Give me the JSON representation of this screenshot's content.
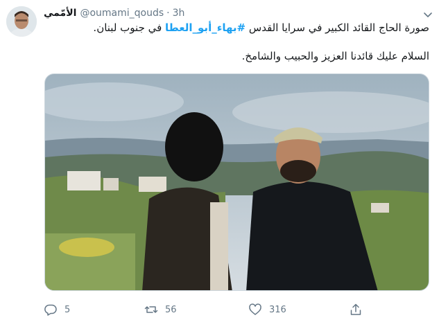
{
  "tweet": {
    "display_name": "الأمّمي",
    "handle": "@oumami_qouds",
    "separator": "·",
    "time": "3h",
    "text_line1_before": "صورة الحاج القائد الكبير في سرايا القدس ",
    "hashtag": "#بهاء_أبو_العطا",
    "text_line1_after": " في جنوب لبنان.",
    "text_line2": "السلام عليك قائدنا العزيز والحبيب والشامخ."
  },
  "actions": {
    "reply_count": "5",
    "retweet_count": "56",
    "like_count": "316"
  },
  "icons": {
    "reply": "reply-icon",
    "retweet": "retweet-icon",
    "like": "heart-icon",
    "share": "share-icon",
    "caret": "chevron-down-icon"
  },
  "colors": {
    "accent": "#1da1f2",
    "secondary_text": "#657786",
    "text": "#14171a"
  }
}
